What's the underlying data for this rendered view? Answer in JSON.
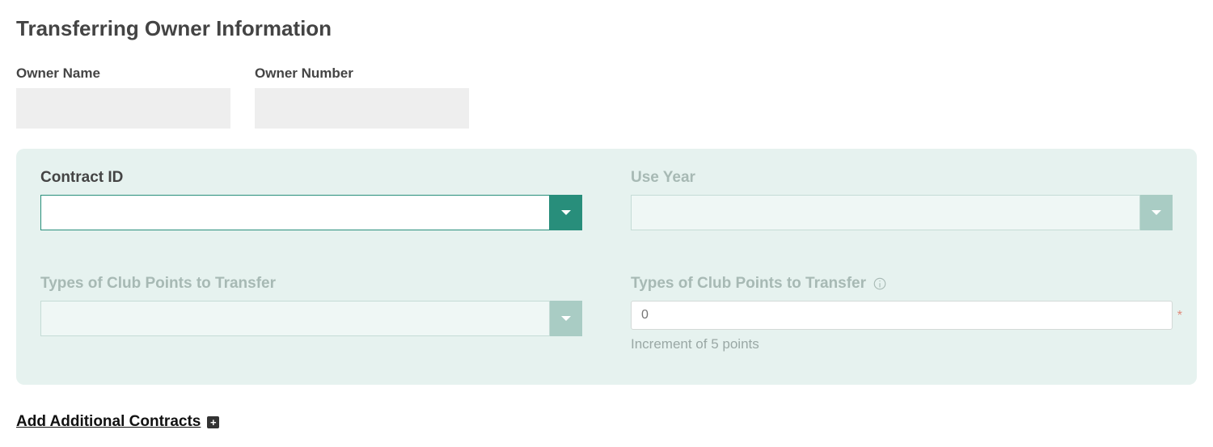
{
  "page": {
    "title": "Transferring Owner Information"
  },
  "owner": {
    "name_label": "Owner Name",
    "name_value": "",
    "number_label": "Owner Number",
    "number_value": ""
  },
  "contract": {
    "contract_id_label": "Contract ID",
    "contract_id_value": "",
    "use_year_label": "Use Year",
    "use_year_value": "",
    "points_type_label": "Types of Club Points to Transfer",
    "points_type_value": "",
    "points_amount_label": "Types of Club Points to Transfer",
    "points_amount_placeholder": "0",
    "points_amount_value": "",
    "points_helper": "Increment of 5 points"
  },
  "actions": {
    "add_contracts_label": "Add Additional Contracts"
  }
}
